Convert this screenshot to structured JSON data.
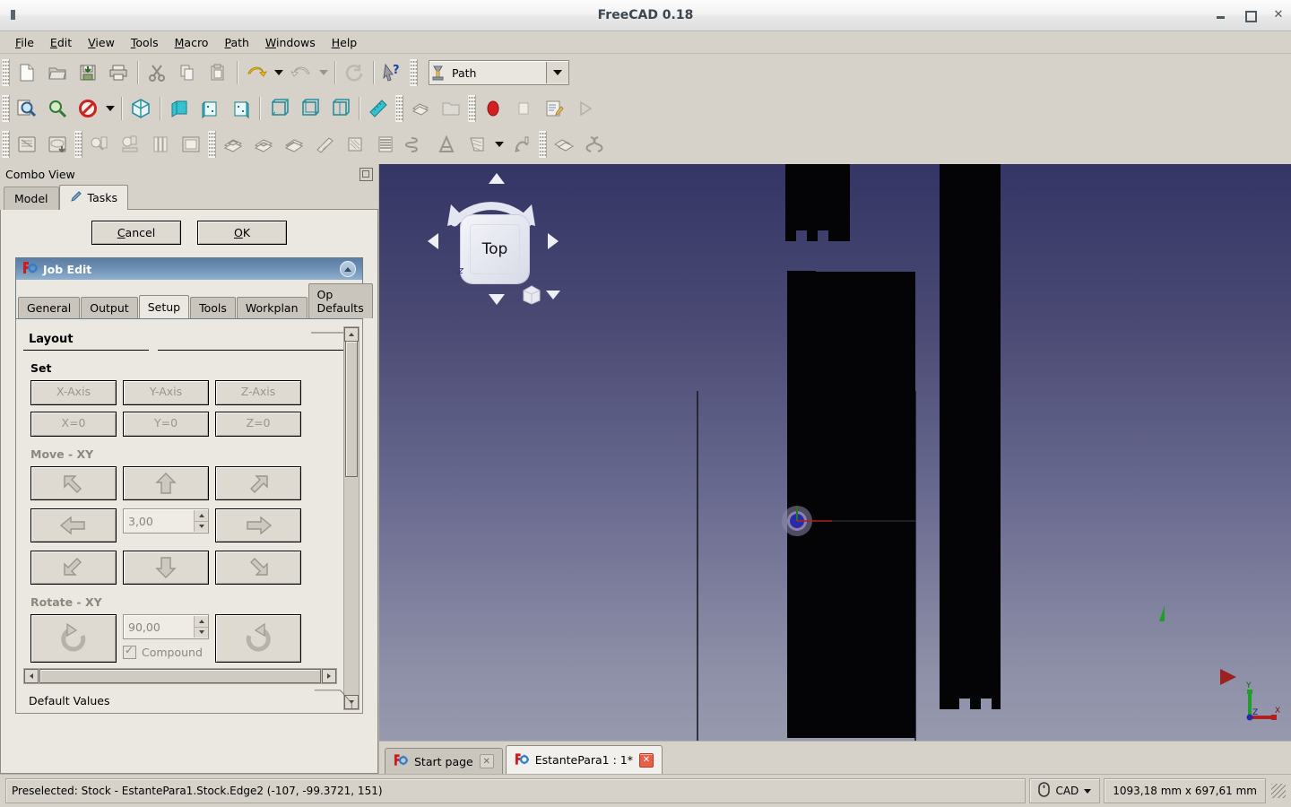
{
  "window": {
    "title": "FreeCAD 0.18",
    "buttons": {
      "minimize": "minimize-button",
      "maximize": "maximize-button",
      "close": "✕"
    }
  },
  "menu": {
    "items": [
      {
        "label": "File",
        "mnemonic": "F"
      },
      {
        "label": "Edit",
        "mnemonic": "E"
      },
      {
        "label": "View",
        "mnemonic": "V"
      },
      {
        "label": "Tools",
        "mnemonic": "T"
      },
      {
        "label": "Macro",
        "mnemonic": "M"
      },
      {
        "label": "Path",
        "mnemonic": "P"
      },
      {
        "label": "Windows",
        "mnemonic": "W"
      },
      {
        "label": "Help",
        "mnemonic": "H"
      }
    ]
  },
  "workbench": {
    "selected": "Path"
  },
  "combo_view": {
    "title": "Combo View",
    "tabs": [
      {
        "label": "Model",
        "active": false
      },
      {
        "label": "Tasks",
        "active": true
      }
    ]
  },
  "tasks": {
    "cancel_label": "Cancel",
    "ok_label": "OK",
    "job_edit": {
      "title": "Job Edit",
      "tabs": [
        {
          "label": "General",
          "active": false
        },
        {
          "label": "Output",
          "active": false
        },
        {
          "label": "Setup",
          "active": true
        },
        {
          "label": "Tools",
          "active": false
        },
        {
          "label": "Workplan",
          "active": false
        },
        {
          "label": "Op Defaults",
          "active": false
        }
      ],
      "layout": {
        "group_title": "Layout",
        "set_label": "Set",
        "set_buttons": [
          "X-Axis",
          "Y-Axis",
          "Z-Axis",
          "X=0",
          "Y=0",
          "Z=0"
        ],
        "move_label": "Move - XY",
        "move_value": "3,00",
        "rotate_label": "Rotate - XY",
        "rotate_value": "90,00",
        "compound_label": "Compound",
        "compound_checked": true
      },
      "default_values_title": "Default Values"
    }
  },
  "view3d": {
    "nav_cube_face": "Top",
    "nav_axis_label": "z",
    "axis_indicator": {
      "x": "X",
      "y": "Y",
      "z": "Z"
    }
  },
  "doc_tabs": [
    {
      "label": "Start page",
      "active": false,
      "close": "✕"
    },
    {
      "label": "EstantePara1 : 1*",
      "active": true,
      "close": "✕"
    }
  ],
  "status": {
    "message": "Preselected: Stock - EstantePara1.Stock.Edge2 (-107, -99.3721, 151)",
    "nav_mode": "CAD",
    "dimensions": "1093,18 mm x 697,61 mm"
  },
  "colors": {
    "titlebar_text": "#3b4650",
    "panel_bg": "#d6d2ca",
    "job_header_from": "#5c7da3",
    "job_header_to": "#8fb0cd",
    "view_bg_top": "#353566",
    "view_bg_bottom": "#9799ae",
    "axis_x": "#c03030",
    "axis_y": "#2aa82a",
    "axis_z": "#2a2ac0",
    "origin_marker": "#2a2aa8"
  }
}
